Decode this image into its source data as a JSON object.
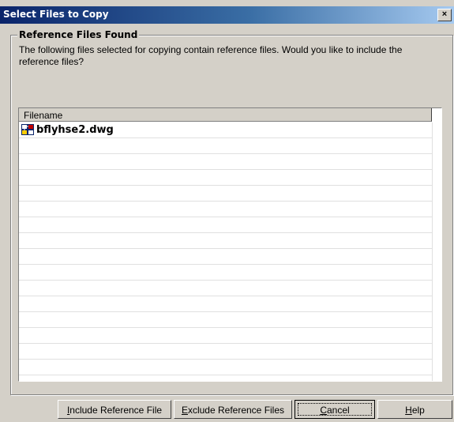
{
  "window": {
    "title": "Select Files to Copy",
    "close_label": "×"
  },
  "group": {
    "label": "Reference Files Found",
    "description": "The following files selected for copying contain reference files. Would you like to include the reference files?"
  },
  "list": {
    "column_header": "Filename",
    "files": [
      {
        "name": "bflyhse2.dwg",
        "icon": "dwg-file-icon"
      }
    ]
  },
  "buttons": {
    "include": {
      "mnemonic": "I",
      "rest": "nclude Reference File"
    },
    "exclude": {
      "mnemonic": "E",
      "rest": "xclude Reference Files"
    },
    "cancel": {
      "mnemonic": "C",
      "rest": "ancel"
    },
    "help": {
      "mnemonic": "H",
      "rest": "elp"
    }
  }
}
